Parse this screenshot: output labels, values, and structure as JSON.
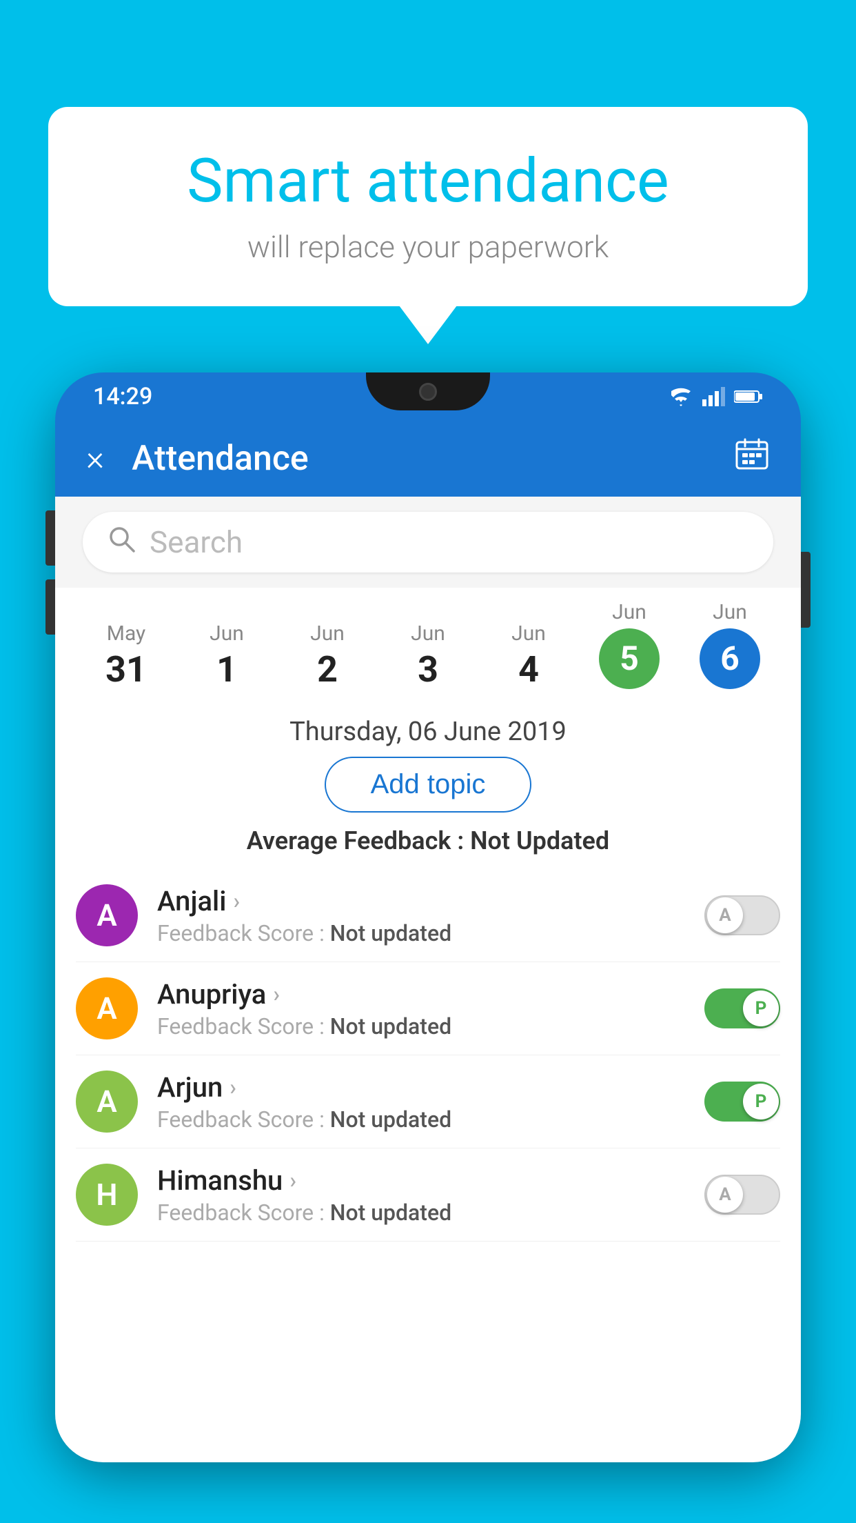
{
  "background_color": "#00BFEA",
  "speech_bubble": {
    "title": "Smart attendance",
    "subtitle": "will replace your paperwork"
  },
  "status_bar": {
    "time": "14:29",
    "icons": [
      "wifi",
      "signal",
      "battery"
    ]
  },
  "app_header": {
    "title": "Attendance",
    "close_label": "×",
    "calendar_icon": "📅"
  },
  "search": {
    "placeholder": "Search"
  },
  "dates": [
    {
      "month": "May",
      "day": "31",
      "style": "normal"
    },
    {
      "month": "Jun",
      "day": "1",
      "style": "normal"
    },
    {
      "month": "Jun",
      "day": "2",
      "style": "normal"
    },
    {
      "month": "Jun",
      "day": "3",
      "style": "normal"
    },
    {
      "month": "Jun",
      "day": "4",
      "style": "normal"
    },
    {
      "month": "Jun",
      "day": "5",
      "style": "green"
    },
    {
      "month": "Jun",
      "day": "6",
      "style": "blue"
    }
  ],
  "selected_date": "Thursday, 06 June 2019",
  "add_topic_label": "Add topic",
  "average_feedback_label": "Average Feedback :",
  "average_feedback_value": "Not Updated",
  "students": [
    {
      "name": "Anjali",
      "initial": "A",
      "avatar_color": "#9C27B0",
      "feedback_label": "Feedback Score :",
      "feedback_value": "Not updated",
      "toggle": "off",
      "toggle_letter": "A"
    },
    {
      "name": "Anupriya",
      "initial": "A",
      "avatar_color": "#FFA000",
      "feedback_label": "Feedback Score :",
      "feedback_value": "Not updated",
      "toggle": "on",
      "toggle_letter": "P"
    },
    {
      "name": "Arjun",
      "initial": "A",
      "avatar_color": "#8BC34A",
      "feedback_label": "Feedback Score :",
      "feedback_value": "Not updated",
      "toggle": "on",
      "toggle_letter": "P"
    },
    {
      "name": "Himanshu",
      "initial": "H",
      "avatar_color": "#8BC34A",
      "feedback_label": "Feedback Score :",
      "feedback_value": "Not updated",
      "toggle": "off",
      "toggle_letter": "A"
    }
  ]
}
